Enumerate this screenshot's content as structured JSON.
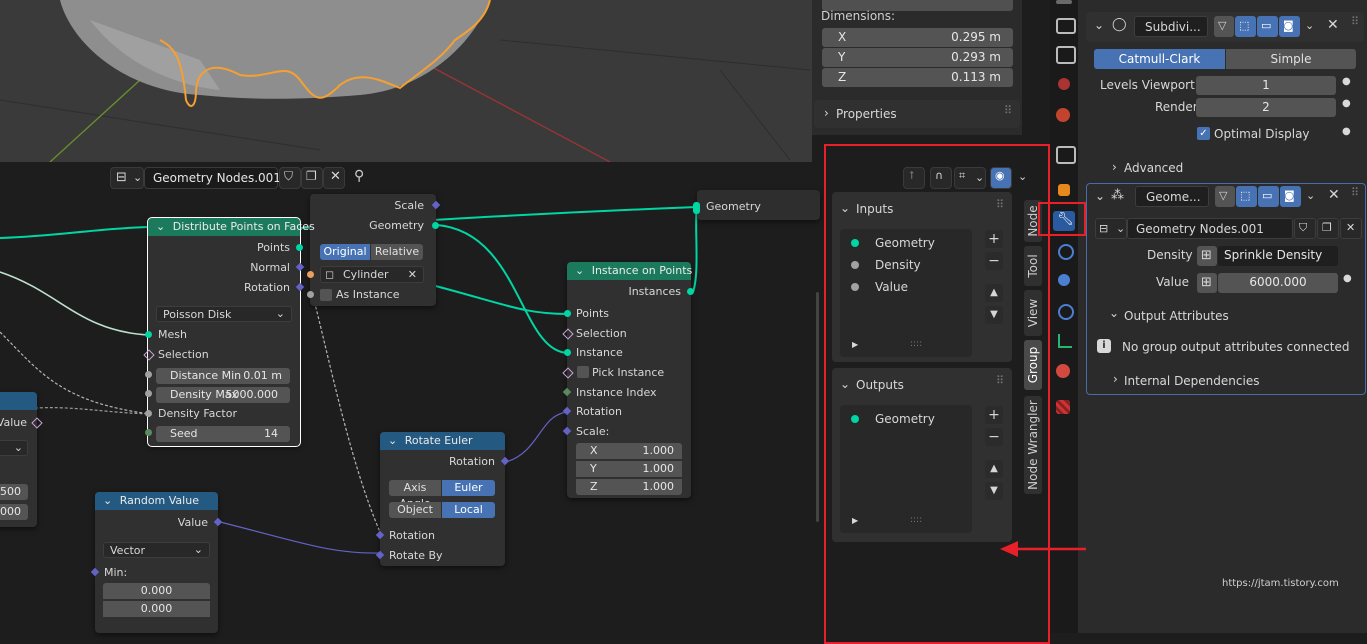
{
  "n_panel": {
    "dimensions_label": "Dimensions:",
    "dims": [
      {
        "axis": "X",
        "value": "0.295 m"
      },
      {
        "axis": "Y",
        "value": "0.293 m"
      },
      {
        "axis": "Z",
        "value": "0.113 m"
      }
    ],
    "properties_label": "Properties"
  },
  "node_editor": {
    "tree_name": "Geometry Nodes.001",
    "group_output_socket": "Geometry",
    "top_node": {
      "scale": "Scale",
      "geometry": "Geometry",
      "mode_original": "Original",
      "mode_relative": "Relative",
      "object": "Cylinder",
      "as_instance": "As Instance"
    },
    "distribute": {
      "title": "Distribute Points on Faces",
      "points": "Points",
      "normal": "Normal",
      "rotation": "Rotation",
      "method": "Poisson Disk",
      "mesh": "Mesh",
      "selection": "Selection",
      "distance_min_label": "Distance Min",
      "distance_min_value": "0.01 m",
      "density_max_label": "Density Max",
      "density_max_value": "5000.000",
      "density_factor": "Density Factor",
      "seed_label": "Seed",
      "seed_value": "14"
    },
    "instance_on_points": {
      "title": "Instance on Points",
      "instances": "Instances",
      "points": "Points",
      "selection": "Selection",
      "instance": "Instance",
      "pick_instance": "Pick Instance",
      "instance_index": "Instance Index",
      "rotation": "Rotation",
      "scale": "Scale:",
      "x_label": "X",
      "x_value": "1.000",
      "y_label": "Y",
      "y_value": "1.000",
      "z_label": "Z",
      "z_value": "1.000"
    },
    "rotate_euler": {
      "title": "Rotate Euler",
      "rotation_out": "Rotation",
      "axis_angle": "Axis Angle",
      "euler": "Euler",
      "object": "Object",
      "local": "Local",
      "rotation_in": "Rotation",
      "rotate_by": "Rotate By"
    },
    "random_value": {
      "title": "Random Value",
      "value": "Value",
      "type": "Vector",
      "min": "Min:",
      "v1": "0.000",
      "v2": "0.000"
    },
    "left_node": {
      "value": "Value",
      "f1": "500",
      "f2": "000"
    }
  },
  "group_panel": {
    "inputs_label": "Inputs",
    "inputs": [
      "Geometry",
      "Density",
      "Value"
    ],
    "outputs_label": "Outputs",
    "outputs": [
      "Geometry"
    ]
  },
  "sidebar_tabs": [
    "Node",
    "Tool",
    "View",
    "Group",
    "Node Wrangler"
  ],
  "properties": {
    "subdiv_name": "Subdivi...",
    "catmull_clark": "Catmull-Clark",
    "simple": "Simple",
    "levels_viewport_label": "Levels Viewport",
    "levels_viewport_value": "1",
    "render_label": "Render",
    "render_value": "2",
    "optimal_display": "Optimal Display",
    "advanced": "Advanced",
    "geo_mod_name": "Geome...",
    "node_group": "Geometry Nodes.001",
    "density_label": "Density",
    "density_value": "Sprinkle Density",
    "value_label": "Value",
    "value_value": "6000.000",
    "output_attributes": "Output Attributes",
    "no_output_msg": "No group output attributes connected",
    "internal_dependencies": "Internal Dependencies"
  },
  "watermark": "https://jtam.tistory.com",
  "colors": {
    "accent_blue": "#4772b3",
    "geometry_socket": "#00d6a3",
    "highlight_red": "#e8202a",
    "header_green": "#1c7a5c",
    "header_blue": "#245a82"
  }
}
